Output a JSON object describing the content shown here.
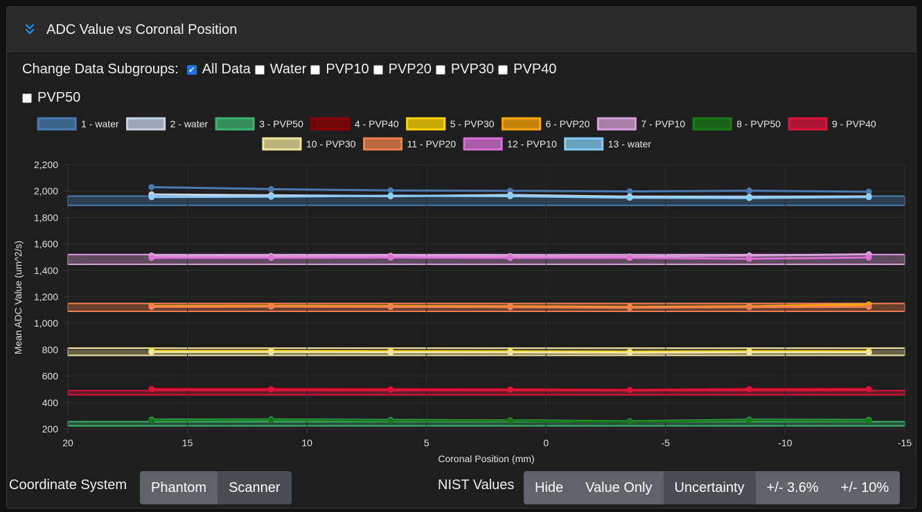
{
  "panel": {
    "title": "ADC Value vs Coronal Position",
    "collapse_icon": "chevron-double-down-icon"
  },
  "subgroups": {
    "label": "Change Data Subgroups:",
    "options": [
      {
        "label": "All Data",
        "checked": true
      },
      {
        "label": "Water",
        "checked": false
      },
      {
        "label": "PVP10",
        "checked": false
      },
      {
        "label": "PVP20",
        "checked": false
      },
      {
        "label": "PVP30",
        "checked": false
      },
      {
        "label": "PVP40",
        "checked": false
      },
      {
        "label": "PVP50",
        "checked": false
      }
    ]
  },
  "chart_data": {
    "type": "line",
    "xlabel": "Coronal Position (mm)",
    "ylabel": "Mean ADC Value (um^2/s)",
    "xlim": [
      20,
      -15
    ],
    "ylim": [
      200,
      2200
    ],
    "xticks": [
      20,
      15,
      10,
      5,
      0,
      -5,
      -10,
      -15
    ],
    "yticks": [
      200,
      400,
      600,
      800,
      1000,
      1200,
      1400,
      1600,
      1800,
      2000,
      2200
    ],
    "x": [
      16.5,
      11.5,
      6.5,
      1.5,
      -3.5,
      -8.5,
      -13.5
    ],
    "legend_position": "top",
    "series": [
      {
        "name": "1 - water",
        "color": "#4a7bb0",
        "values": [
          2030,
          2015,
          2005,
          2002,
          1998,
          2003,
          1995
        ]
      },
      {
        "name": "2 - water",
        "color": "#c9d3e6",
        "values": [
          1975,
          1968,
          1962,
          1970,
          1958,
          1955,
          1960
        ]
      },
      {
        "name": "3 - PVP50",
        "color": "#3cb371",
        "values": [
          270,
          272,
          268,
          265,
          258,
          270,
          268
        ]
      },
      {
        "name": "4 - PVP40",
        "color": "#8b0000",
        "values": [
          505,
          505,
          503,
          502,
          498,
          504,
          505
        ]
      },
      {
        "name": "5 - PVP30",
        "color": "#ffd700",
        "values": [
          790,
          790,
          788,
          787,
          784,
          788,
          787
        ]
      },
      {
        "name": "6 - PVP20",
        "color": "#ffa500",
        "values": [
          1130,
          1132,
          1130,
          1128,
          1123,
          1128,
          1142
        ]
      },
      {
        "name": "7 - PVP10",
        "color": "#d8a0d8",
        "values": [
          1512,
          1508,
          1510,
          1507,
          1505,
          1512,
          1522
        ]
      },
      {
        "name": "8 - PVP50",
        "color": "#1a7a1a",
        "values": [
          265,
          268,
          263,
          262,
          255,
          265,
          262
        ]
      },
      {
        "name": "9 - PVP40",
        "color": "#dc143c",
        "values": [
          500,
          500,
          498,
          497,
          494,
          500,
          500
        ]
      },
      {
        "name": "10 - PVP30",
        "color": "#f0e6a0",
        "values": [
          782,
          782,
          780,
          779,
          776,
          780,
          780
        ]
      },
      {
        "name": "11 - PVP20",
        "color": "#f08050",
        "values": [
          1124,
          1126,
          1124,
          1122,
          1118,
          1122,
          1125
        ]
      },
      {
        "name": "12 - PVP10",
        "color": "#da70d6",
        "values": [
          1495,
          1495,
          1497,
          1495,
          1495,
          1488,
          1498
        ]
      },
      {
        "name": "13 - water",
        "color": "#87cefa",
        "values": [
          1955,
          1958,
          1965,
          1962,
          1950,
          1948,
          1955
        ]
      }
    ],
    "reference_bands": [
      {
        "color": "#4a7bb0",
        "low": 1892,
        "high": 1962
      },
      {
        "color": "#d8a0d8",
        "low": 1446,
        "high": 1520
      },
      {
        "color": "#f08050",
        "low": 1090,
        "high": 1150
      },
      {
        "color": "#f0e6a0",
        "low": 757,
        "high": 812
      },
      {
        "color": "#dc143c",
        "low": 460,
        "high": 490
      },
      {
        "color": "#3cb371",
        "low": 235,
        "high": 255
      }
    ]
  },
  "coordinate_system": {
    "label": "Coordinate System",
    "options": [
      "Phantom",
      "Scanner"
    ],
    "active": "Scanner"
  },
  "nist_values": {
    "label": "NIST Values",
    "options": [
      "Hide",
      "Value Only",
      "Uncertainty",
      "+/- 3.6%",
      "+/- 10%"
    ],
    "active": "Uncertainty"
  }
}
